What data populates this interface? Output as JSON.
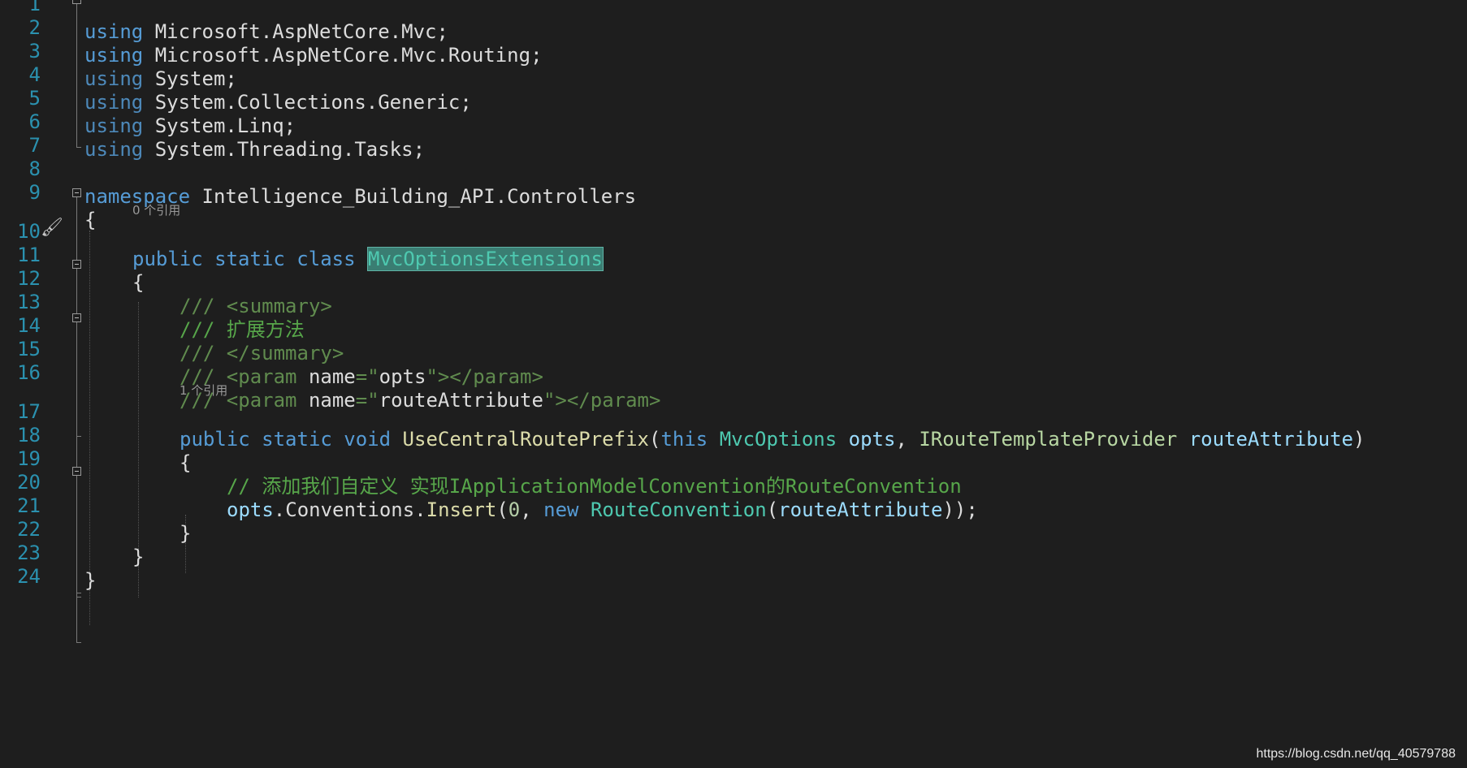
{
  "editor": {
    "lines": [
      {
        "n": "1"
      },
      {
        "n": "2"
      },
      {
        "n": "3"
      },
      {
        "n": "4"
      },
      {
        "n": "5"
      },
      {
        "n": "6"
      },
      {
        "n": "7"
      },
      {
        "n": "8"
      },
      {
        "n": "9"
      },
      {
        "n": "10"
      },
      {
        "n": "11"
      },
      {
        "n": "12"
      },
      {
        "n": "13"
      },
      {
        "n": "14"
      },
      {
        "n": "15"
      },
      {
        "n": "16"
      },
      {
        "n": "17"
      },
      {
        "n": "18"
      },
      {
        "n": "19"
      },
      {
        "n": "20"
      },
      {
        "n": "21"
      },
      {
        "n": "22"
      },
      {
        "n": "23"
      },
      {
        "n": "24"
      }
    ],
    "code": {
      "l1": {
        "kw": "using",
        "rest": " Microsoft.AspNetCore.Mvc;"
      },
      "l2": {
        "kw": "using",
        "rest": " Microsoft.AspNetCore.Mvc.Routing;"
      },
      "l3": {
        "kw": "using",
        "rest": " System;"
      },
      "l4": {
        "kw": "using",
        "rest": " System.Collections.Generic;"
      },
      "l5": {
        "kw": "using",
        "rest": " System.Linq;"
      },
      "l6": {
        "kw": "using",
        "rest": " System.Threading.Tasks;"
      },
      "l8": {
        "kw": "namespace",
        "rest": " Intelligence_Building_API.Controllers"
      },
      "l9": {
        "text": "{"
      },
      "l10": {
        "kw": "public static class",
        "space": " ",
        "name": "MvcOptionsExtensions"
      },
      "l11": {
        "text": "{"
      },
      "l12": {
        "slashes": "/// ",
        "tag": "<summary>"
      },
      "l13": {
        "slashes": "/// ",
        "text": "扩展方法"
      },
      "l14": {
        "slashes": "/// ",
        "tag": "</summary>"
      },
      "l15": {
        "slashes": "/// ",
        "open": "<param ",
        "attr": "name",
        "eq": "=\"",
        "val": "opts",
        "q": "\"",
        "close": "></param>"
      },
      "l16": {
        "slashes": "/// ",
        "open": "<param ",
        "attr": "name",
        "eq": "=\"",
        "val": "routeAttribute",
        "q": "\"",
        "close": "></param>"
      },
      "l17": {
        "kw": "public static void",
        "method": " UseCentralRoutePrefix",
        "p1": "(",
        "kw2": "this",
        "sp1": " ",
        "type1": "MvcOptions",
        "sp2": " ",
        "var1": "opts",
        "comma": ", ",
        "type2": "IRouteTemplateProvider",
        "sp3": " ",
        "var2": "routeAttribute",
        "p2": ")"
      },
      "l18": {
        "text": "{"
      },
      "l19": {
        "comment": "// 添加我们自定义 实现IApplicationModelConvention的RouteConvention"
      },
      "l20": {
        "var": "opts",
        "dot1": ".Conventions.",
        "method": "Insert",
        "p1": "(",
        "num": "0",
        "comma": ", ",
        "kw": "new",
        "sp": " ",
        "type": "RouteConvention",
        "p2": "(",
        "var2": "routeAttribute",
        "p3": "));"
      },
      "l21": {
        "text": "}"
      },
      "l22": {
        "text": "}"
      },
      "l23": {
        "text": "}"
      }
    },
    "codelens": {
      "class_refs": "0 个引用",
      "method_refs": "1 个引用"
    }
  },
  "watermark": "https://blog.csdn.net/qq_40579788"
}
